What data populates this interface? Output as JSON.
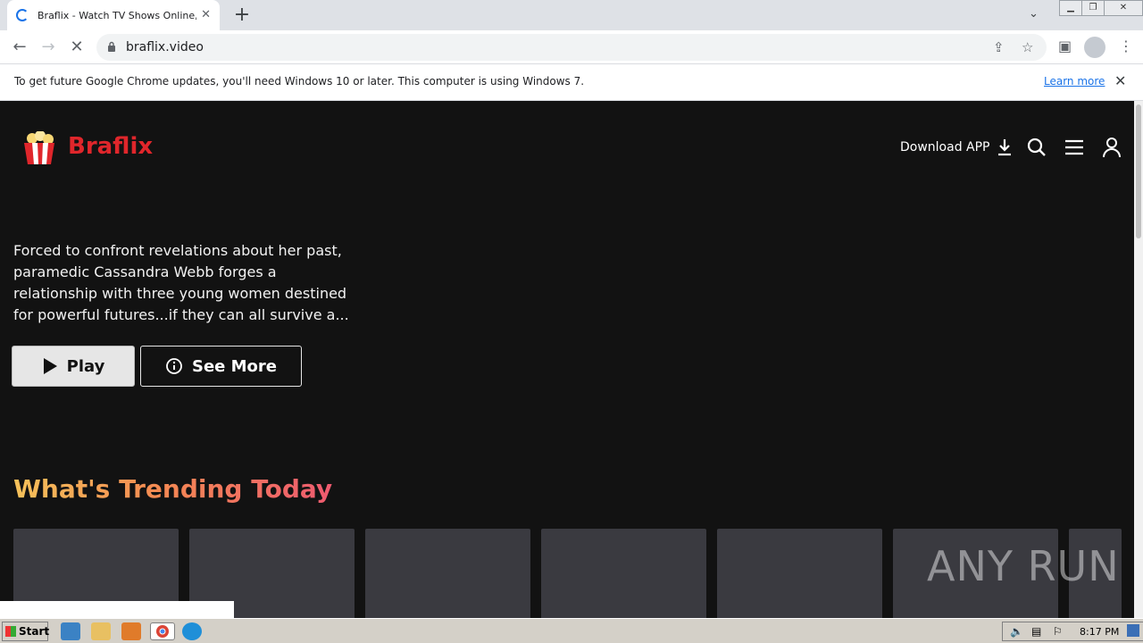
{
  "browser": {
    "tab_title": "Braflix - Watch TV Shows Online, Watch",
    "url": "braflix.video",
    "infobar_message": "To get future Google Chrome updates, you'll need Windows 10 or later. This computer is using Windows 7.",
    "infobar_link": "Learn more"
  },
  "site": {
    "brand": "Braflix",
    "download_label": "Download APP",
    "hero_description": "Forced to confront revelations about her past, paramedic Cassandra Webb forges a relationship with three young women destined for powerful futures...if they can all survive a...",
    "play_label": "Play",
    "see_more_label": "See More",
    "trending_title": "What's Trending Today"
  },
  "watermark": "ANY RUN",
  "taskbar": {
    "start_label": "Start",
    "clock": "8:17 PM"
  },
  "colors": {
    "brand_red": "#e0262b",
    "page_bg": "#121212",
    "card_bg": "#3a3a40"
  }
}
